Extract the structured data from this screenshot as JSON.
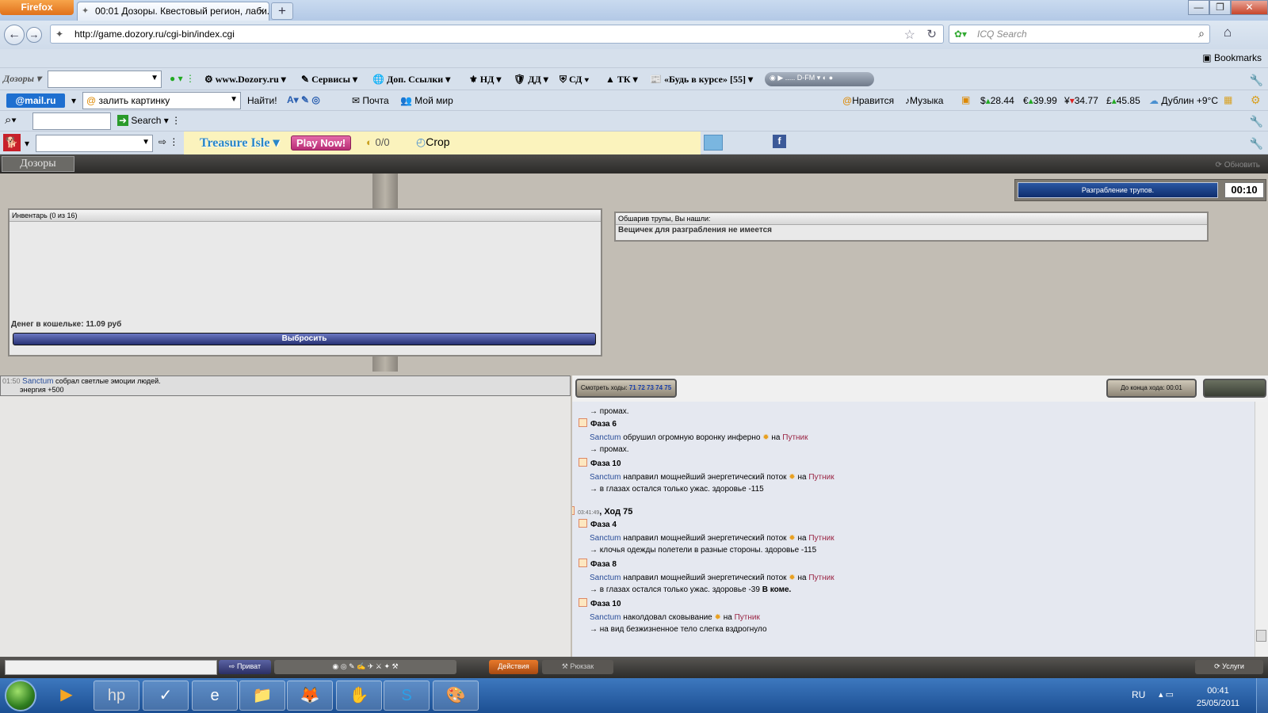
{
  "window": {
    "menu_button": "Firefox",
    "tab_title": "00:01 Дозоры. Квестовый регион, лаби...",
    "new_tab": "+",
    "minimize": "—",
    "restore": "❐",
    "close": "✕",
    "tab_close": "×"
  },
  "nav": {
    "url": "http://game.dozory.ru/cgi-bin/index.cgi",
    "search_placeholder": "ICQ Search",
    "back": "←",
    "forward": "→",
    "star": "☆",
    "reload": "↻",
    "home": "⌂",
    "search_icon": "⌕"
  },
  "bookmarks_label": "Bookmarks",
  "toolbar1": {
    "logo": "Дозоры",
    "site": "www.Dozory.ru",
    "services": "Сервисы",
    "links": "Доп. Ссылки",
    "nd": "НД",
    "dd": "ДД",
    "sd": "СД",
    "tk": "ТК",
    "news": "«Будь в курсе» [55]",
    "radio": "D-FM"
  },
  "toolbar2": {
    "brand": "@mail.ru",
    "upload": "залить картинку",
    "find": "Найти!",
    "mail": "Почта",
    "myworld": "Мой мир",
    "like": "Нравится",
    "music": "Музыка",
    "usd": "28.44",
    "eur": "39.99",
    "jpy": "34.77",
    "gbp": "45.85",
    "weather": "Дублин +9°C"
  },
  "toolbar3": {
    "search_btn": "Search"
  },
  "toolbar4": {
    "game": "Treasure Isle",
    "play": "Play Now!",
    "counter": "0/0",
    "crop": "Crop"
  },
  "game": {
    "logo": "Дозоры",
    "refresh": "Обновить",
    "action_label": "Разграбление трупов.",
    "timer": "00:10",
    "inventory_title": "Инвентарь (0 из 16)",
    "wallet": "Денег в кошельке: 11.09 руб",
    "drop_button": "Выбросить",
    "search_title": "Обшарив трупы, Вы нашли:",
    "search_result": "Вещичек для разграбления не имеется",
    "left_msg_time": "01:50",
    "left_msg_name": "Sanctum",
    "left_msg_text": "собрал светлые эмоции людей.",
    "left_msg_energy": "энергия +500",
    "view_moves_label": "Смотреть ходы:",
    "view_moves_nums": "71 72 73 74 75",
    "end_move": "До конца хода: 00:01",
    "log": [
      {
        "type": "res",
        "text": "→ промах."
      },
      {
        "type": "phase",
        "text": "Фаза 6"
      },
      {
        "type": "act",
        "name": "Sanctum",
        "text": " обрушил огромную воронку инферно ",
        "on": " на ",
        "target": "Путник"
      },
      {
        "type": "res",
        "text": "→ промах."
      },
      {
        "type": "phase",
        "text": "Фаза 10"
      },
      {
        "type": "act",
        "name": "Sanctum",
        "text": " направил мощнейший энергетический поток ",
        "on": " на ",
        "target": "Путник"
      },
      {
        "type": "res",
        "text": "→ в глазах остался только ужас. здоровье -115"
      },
      {
        "type": "move",
        "time": "03:41:49",
        "text": ", Ход 75"
      },
      {
        "type": "phase",
        "text": "Фаза 4"
      },
      {
        "type": "act",
        "name": "Sanctum",
        "text": " направил мощнейший энергетический поток ",
        "on": " на ",
        "target": "Путник"
      },
      {
        "type": "res",
        "text": "→ клочья одежды полетели в разные стороны. здоровье -115"
      },
      {
        "type": "phase",
        "text": "Фаза 8"
      },
      {
        "type": "act",
        "name": "Sanctum",
        "text": " направил мощнейший энергетический поток ",
        "on": " на ",
        "target": "Путник"
      },
      {
        "type": "res",
        "text": "→ в глазах остался только ужас. здоровье -39 ",
        "bold": "В коме."
      },
      {
        "type": "phase",
        "text": "Фаза 10"
      },
      {
        "type": "act",
        "name": "Sanctum",
        "text": " наколдовал сковывание ",
        "on": " на ",
        "target": "Путник"
      },
      {
        "type": "res",
        "text": "→ на вид безжизненное тело слегка вздрогнуло"
      }
    ],
    "private": "Приват",
    "actions": "Действия",
    "backpack": "Рюкзак",
    "services": "Услуги"
  },
  "taskbar": {
    "lang": "RU",
    "time": "00:41",
    "date": "25/05/2011",
    "apps": [
      "▶",
      "hp",
      "✓",
      "e",
      "📁",
      "🦊",
      "✋",
      "S",
      "🎨"
    ]
  }
}
